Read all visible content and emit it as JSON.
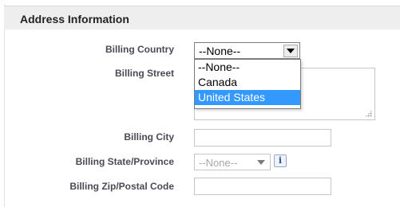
{
  "section": {
    "title": "Address Information"
  },
  "fields": {
    "billing_country": {
      "label": "Billing Country",
      "value": "--None--"
    },
    "billing_street": {
      "label": "Billing Street",
      "value": ""
    },
    "billing_city": {
      "label": "Billing City",
      "value": ""
    },
    "billing_state": {
      "label": "Billing State/Province",
      "value": "--None--"
    },
    "billing_zip": {
      "label": "Billing Zip/Postal Code",
      "value": ""
    }
  },
  "country_dropdown": {
    "options": [
      "--None--",
      "Canada",
      "United States"
    ],
    "highlighted": "United States"
  },
  "icons": {
    "state_info": "info-icon",
    "info_glyph": "i"
  },
  "colors": {
    "highlight": "#3399ff",
    "header_bg": "#eeeeee"
  }
}
